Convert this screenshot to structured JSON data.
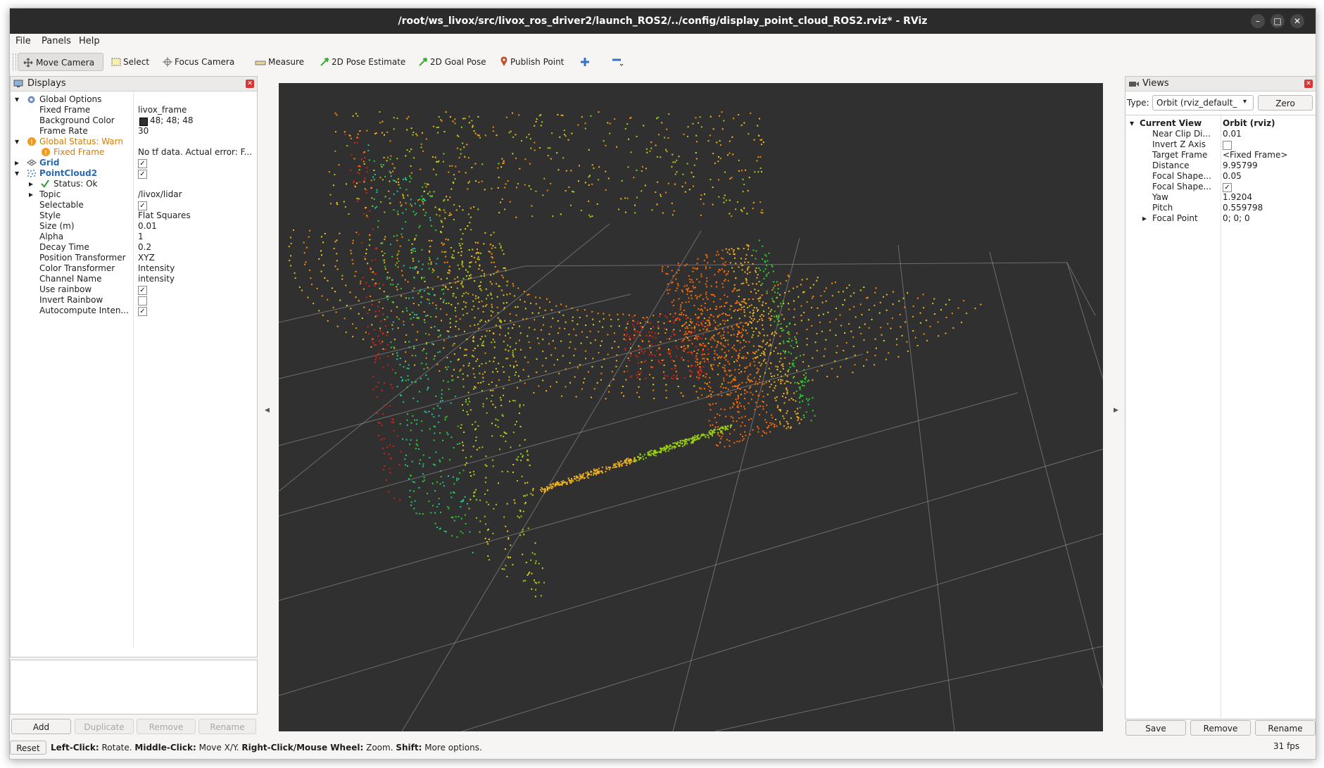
{
  "window": {
    "title": "/root/ws_livox/src/livox_ros_driver2/launch_ROS2/../config/display_point_cloud_ROS2.rviz* - RViz",
    "controls": [
      "–",
      "□",
      "✕"
    ]
  },
  "menubar": {
    "file": "File",
    "panels": "Panels",
    "help": "Help"
  },
  "toolbar": {
    "move_camera": "Move Camera",
    "select": "Select",
    "focus_camera": "Focus Camera",
    "measure": "Measure",
    "pose_estimate": "2D Pose Estimate",
    "goal_pose": "2D Goal Pose",
    "publish_point": "Publish Point"
  },
  "displays": {
    "title": "Displays",
    "rows": [
      {
        "label": "Global Options",
        "value": ""
      },
      {
        "label": "Fixed Frame",
        "value": "livox_frame"
      },
      {
        "label": "Background Color",
        "value": "48; 48; 48"
      },
      {
        "label": "Frame Rate",
        "value": "30"
      },
      {
        "label": "Global Status: Warn",
        "value": ""
      },
      {
        "label": "Fixed Frame",
        "value": "No tf data.  Actual error: F..."
      },
      {
        "label": "Grid",
        "value": "✓"
      },
      {
        "label": "PointCloud2",
        "value": "✓"
      },
      {
        "label": "Status: Ok",
        "value": ""
      },
      {
        "label": "Topic",
        "value": "/livox/lidar"
      },
      {
        "label": "Selectable",
        "value": "✓"
      },
      {
        "label": "Style",
        "value": "Flat Squares"
      },
      {
        "label": "Size (m)",
        "value": "0.01"
      },
      {
        "label": "Alpha",
        "value": "1"
      },
      {
        "label": "Decay Time",
        "value": "0.2"
      },
      {
        "label": "Position Transformer",
        "value": "XYZ"
      },
      {
        "label": "Color Transformer",
        "value": "Intensity"
      },
      {
        "label": "Channel Name",
        "value": "intensity"
      },
      {
        "label": "Use rainbow",
        "value": "✓"
      },
      {
        "label": "Invert Rainbow",
        "value": ""
      },
      {
        "label": "Autocompute Inten...",
        "value": "✓"
      }
    ],
    "buttons": {
      "add": "Add",
      "duplicate": "Duplicate",
      "remove": "Remove",
      "rename": "Rename"
    }
  },
  "views": {
    "title": "Views",
    "type_label": "Type:",
    "type_value": "Orbit (rviz_default_",
    "zero": "Zero",
    "rows": [
      {
        "label": "Current View",
        "value": "Orbit (rviz)"
      },
      {
        "label": "Near Clip Di...",
        "value": "0.01"
      },
      {
        "label": "Invert Z Axis",
        "value": ""
      },
      {
        "label": "Target Frame",
        "value": "<Fixed Frame>"
      },
      {
        "label": "Distance",
        "value": "9.95799"
      },
      {
        "label": "Focal Shape...",
        "value": "0.05"
      },
      {
        "label": "Focal Shape...",
        "value": "✓"
      },
      {
        "label": "Yaw",
        "value": "1.9204"
      },
      {
        "label": "Pitch",
        "value": "0.559798"
      },
      {
        "label": "Focal Point",
        "value": "0; 0; 0"
      }
    ],
    "buttons": {
      "save": "Save",
      "remove": "Remove",
      "rename": "Rename"
    }
  },
  "statusbar": {
    "reset": "Reset",
    "left_click": "Left-Click:",
    "left_click_desc": " Rotate. ",
    "middle_click": "Middle-Click:",
    "middle_click_desc": " Move X/Y. ",
    "right_click": "Right-Click/Mouse Wheel:",
    "right_click_desc": " Zoom. ",
    "shift": "Shift:",
    "shift_desc": " More options.",
    "fps": "31 fps"
  },
  "colors": {
    "background": "#303030",
    "grid": "#a0a0a0",
    "warn": "#d47b00",
    "link": "#2a6ab5"
  }
}
